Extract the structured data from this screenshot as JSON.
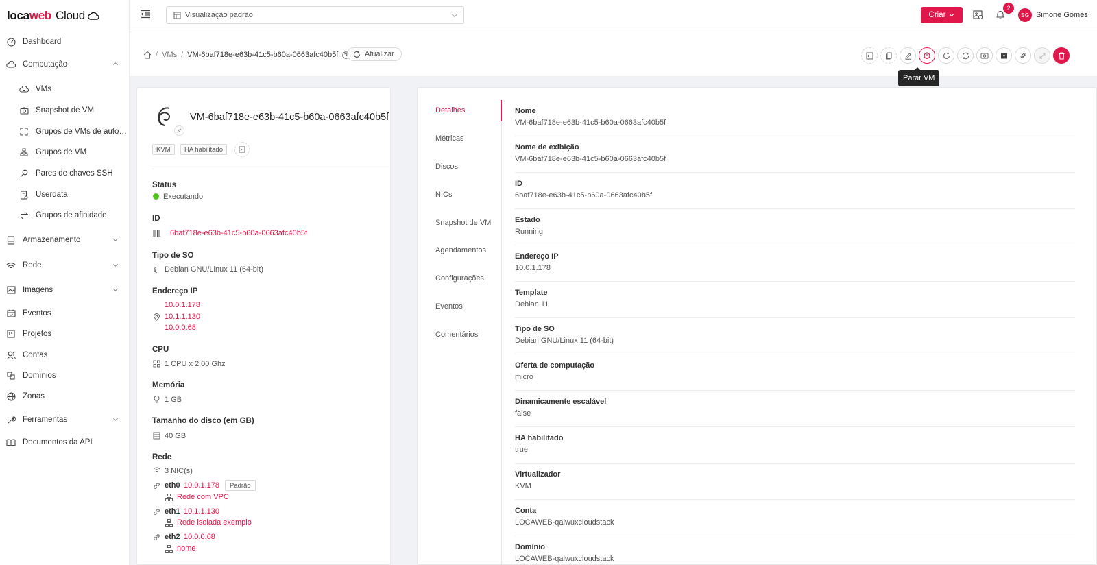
{
  "brand": {
    "loca": "loca",
    "web": "web",
    "cloud": "Cloud"
  },
  "colors": {
    "accent": "#e0174b",
    "running": "#52c41a"
  },
  "sidebar": {
    "items": [
      {
        "label": "Dashboard",
        "icon": "dashboard-icon"
      },
      {
        "label": "Computação",
        "icon": "cloud-icon"
      },
      {
        "label": "VMs",
        "icon": "vm-cloud-icon"
      },
      {
        "label": "Snapshot de VM",
        "icon": "camera-icon"
      },
      {
        "label": "Grupos de VMs de auto…",
        "icon": "expand-icon"
      },
      {
        "label": "Grupos de VM",
        "icon": "cluster-icon"
      },
      {
        "label": "Pares de chaves SSH",
        "icon": "key-icon"
      },
      {
        "label": "Userdata",
        "icon": "document-icon"
      },
      {
        "label": "Grupos de afinidade",
        "icon": "swap-icon"
      },
      {
        "label": "Armazenamento",
        "icon": "storage-icon"
      },
      {
        "label": "Rede",
        "icon": "wifi-icon"
      },
      {
        "label": "Imagens",
        "icon": "image-icon"
      },
      {
        "label": "Eventos",
        "icon": "calendar-icon"
      },
      {
        "label": "Projetos",
        "icon": "project-icon"
      },
      {
        "label": "Contas",
        "icon": "users-icon"
      },
      {
        "label": "Domínios",
        "icon": "block-icon"
      },
      {
        "label": "Zonas",
        "icon": "globe-icon"
      },
      {
        "label": "Ferramentas",
        "icon": "tool-icon"
      },
      {
        "label": "Documentos da API",
        "icon": "book-icon"
      }
    ]
  },
  "header": {
    "view_select": "Visualização padrão",
    "create_label": "Criar",
    "notifications_count": "2",
    "avatar_initials": "SG",
    "user_name": "Simone Gomes"
  },
  "breadcrumb": {
    "items": [
      "VMs",
      "VM-6baf718e-e63b-41c5-b60a-0663afc40b5f"
    ],
    "refresh_label": "Atualizar"
  },
  "tooltip": "Parar VM",
  "vm": {
    "name": "VM-6baf718e-e63b-41c5-b60a-0663afc40b5f",
    "tags": [
      "KVM",
      "HA habilitado"
    ],
    "status_label": "Status",
    "status": "Executando",
    "id_label": "ID",
    "id": "6baf718e-e63b-41c5-b60a-0663afc40b5f",
    "os_label": "Tipo de SO",
    "os": "Debian GNU/Linux 11 (64-bit)",
    "ip_label": "Endereço IP",
    "ips": [
      "10.0.1.178",
      "10.1.1.130",
      "10.0.0.68"
    ],
    "cpu_label": "CPU",
    "cpu": "1 CPU x 2.00 Ghz",
    "memory_label": "Memória",
    "memory": "1 GB",
    "disk_label": "Tamanho do disco (em GB)",
    "disk": "40 GB",
    "network_label": "Rede",
    "nic_count": "3 NIC(s)",
    "nics": [
      {
        "name": "eth0",
        "ip": "10.0.1.178",
        "network": "Rede com VPC",
        "default": "Padrão"
      },
      {
        "name": "eth1",
        "ip": "10.1.1.130",
        "network": "Rede isolada exemplo"
      },
      {
        "name": "eth2",
        "ip": "10.0.0.68",
        "network": "nome"
      }
    ]
  },
  "tabs": [
    "Detalhes",
    "Métricas",
    "Discos",
    "NICs",
    "Snapshot de VM",
    "Agendamentos",
    "Configurações",
    "Eventos",
    "Comentários"
  ],
  "details": [
    {
      "key": "Nome",
      "value": "VM-6baf718e-e63b-41c5-b60a-0663afc40b5f"
    },
    {
      "key": "Nome de exibição",
      "value": "VM-6baf718e-e63b-41c5-b60a-0663afc40b5f"
    },
    {
      "key": "ID",
      "value": "6baf718e-e63b-41c5-b60a-0663afc40b5f"
    },
    {
      "key": "Estado",
      "value": "Running"
    },
    {
      "key": "Endereço IP",
      "value": "10.0.1.178"
    },
    {
      "key": "Template",
      "value": "Debian 11"
    },
    {
      "key": "Tipo de SO",
      "value": "Debian GNU/Linux 11 (64-bit)"
    },
    {
      "key": "Oferta de computação",
      "value": "micro"
    },
    {
      "key": "Dinamicamente escalável",
      "value": "false"
    },
    {
      "key": "HA habilitado",
      "value": "true"
    },
    {
      "key": "Virtualizador",
      "value": "KVM"
    },
    {
      "key": "Conta",
      "value": "LOCAWEB-qalwuxcloudstack"
    },
    {
      "key": "Domínio",
      "value": "LOCAWEB-qalwuxcloudstack"
    }
  ]
}
